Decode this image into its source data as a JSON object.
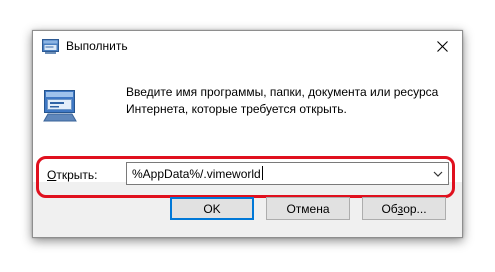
{
  "window": {
    "title": "Выполнить",
    "title_icon": "run-dialog-icon",
    "close_icon": "close-icon"
  },
  "prompt": {
    "line1": "Введите имя программы, папки, документа или ресурса",
    "line2": "Интернета, которые требуется открыть.",
    "icon": "run-program-icon"
  },
  "open_field": {
    "label_mnemonic": "О",
    "label_rest": "ткрыть:",
    "value": "%AppData%/.vimeworld",
    "arrow_icon": "chevron-down-icon"
  },
  "highlight_color": "#e0101e",
  "buttons": {
    "ok": "OK",
    "cancel": "Отмена",
    "browse_prefix": "Об",
    "browse_mnemonic": "з",
    "browse_suffix": "ор..."
  }
}
